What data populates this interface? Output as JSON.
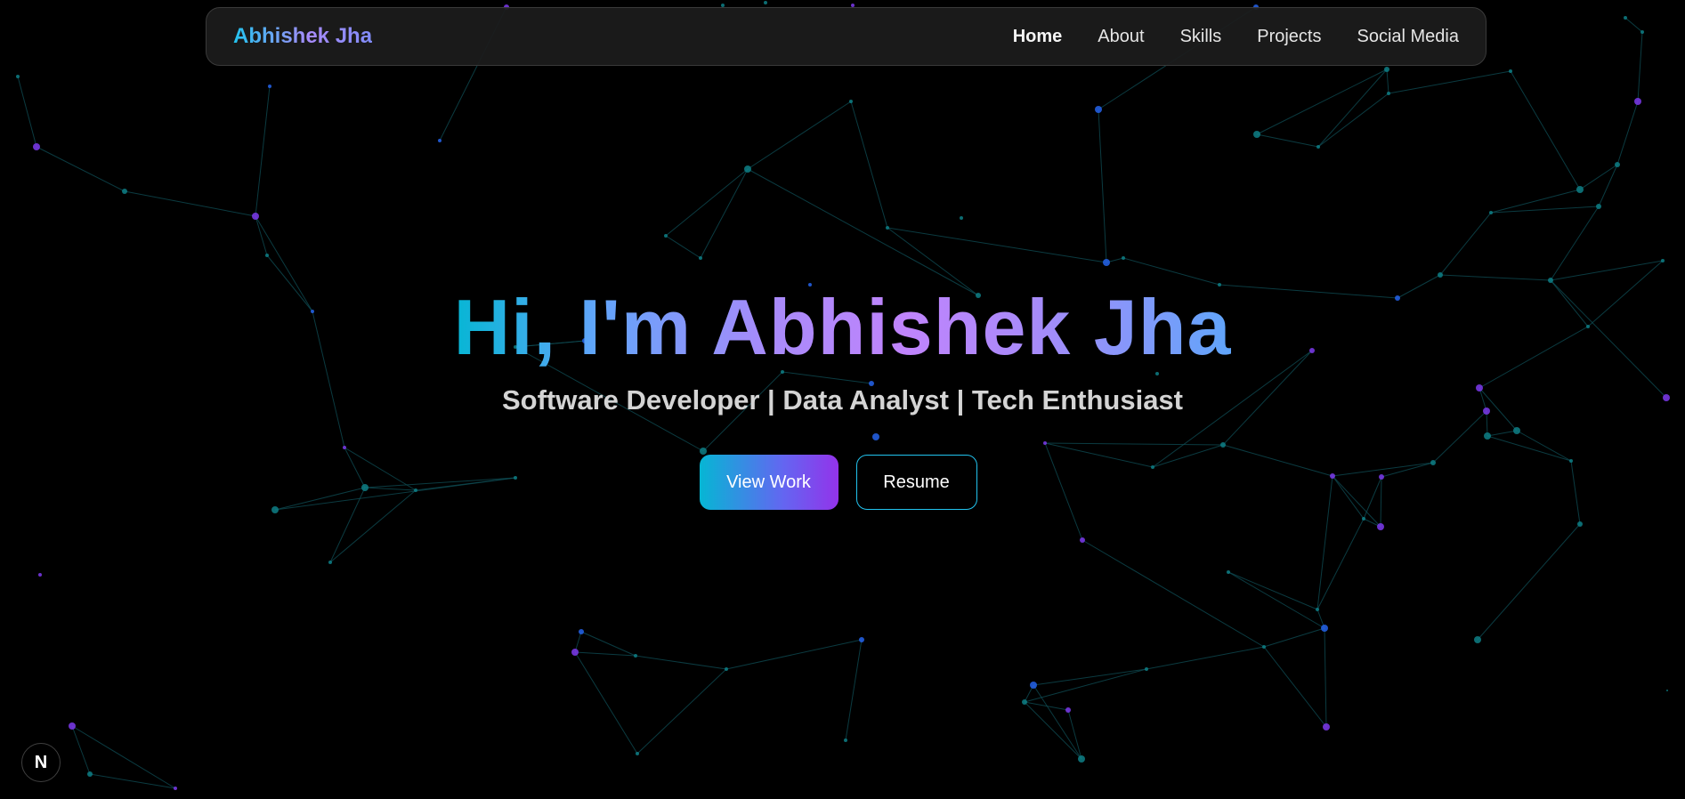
{
  "navbar": {
    "brand": "Abhishek Jha",
    "links": [
      {
        "label": "Home",
        "active": true
      },
      {
        "label": "About",
        "active": false
      },
      {
        "label": "Skills",
        "active": false
      },
      {
        "label": "Projects",
        "active": false
      },
      {
        "label": "Social Media",
        "active": false
      }
    ]
  },
  "hero": {
    "title": "Hi, I'm Abhishek Jha",
    "subtitle": "Software Developer | Data Analyst | Tech Enthusiast",
    "primary_button": "View Work",
    "secondary_button": "Resume"
  },
  "corner_badge": {
    "letter": "N",
    "icon": "nextjs-logo-icon"
  },
  "background": {
    "type": "particle-network",
    "colors": {
      "background": "#000000",
      "teal_node": "#0e7f86",
      "purple_node": "#7c3aed",
      "blue_node": "#2563eb",
      "link": "#0f4f57"
    }
  },
  "colors": {
    "accent_cyan": "#22c3ee",
    "accent_purple": "#9333ea",
    "nav_text": "#e5e5e5",
    "subtitle_text": "#d4d4d4"
  }
}
